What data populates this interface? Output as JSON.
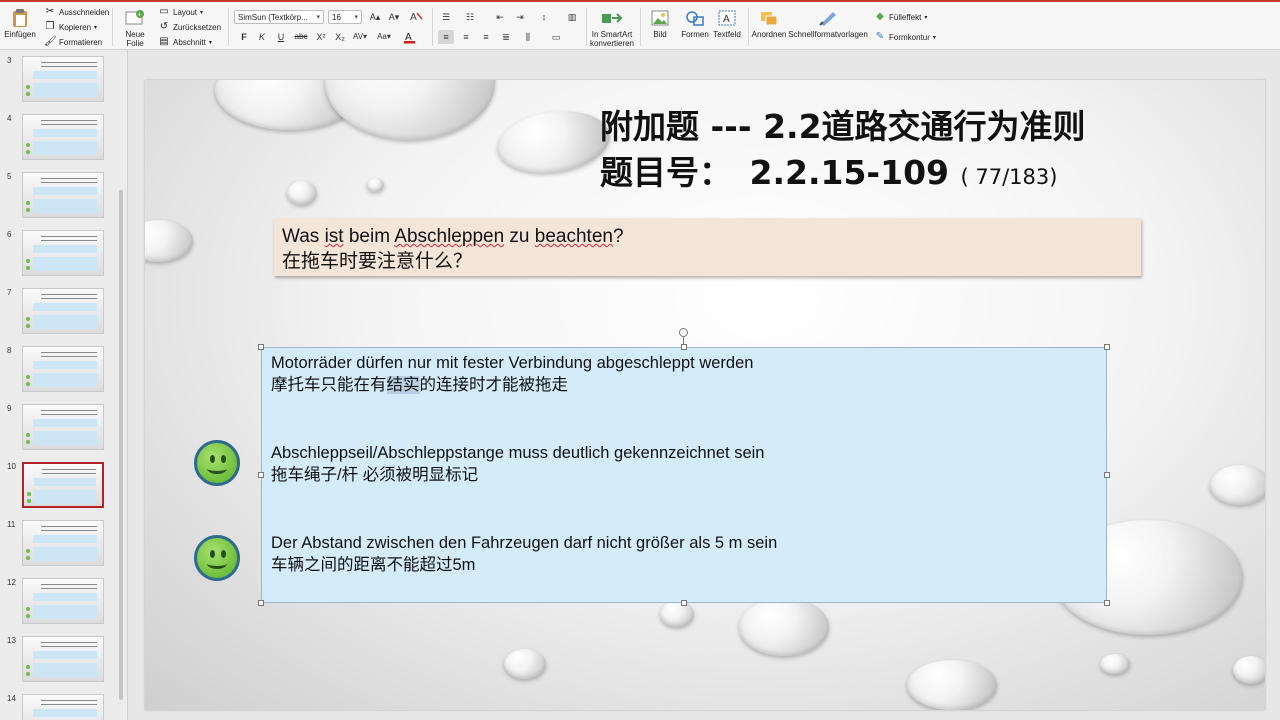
{
  "ribbon": {
    "paste_label": "Einfügen",
    "cut_label": "Ausschneiden",
    "copy_label": "Kopieren",
    "format_painter_label": "Formatieren",
    "new_slide_label": "Neue\nFolie",
    "layout_label": "Layout",
    "reset_label": "Zurücksetzen",
    "section_label": "Abschnitt",
    "font_name": "SimSun (Textkörp...",
    "font_size": "16",
    "picture_label": "Bild",
    "shapes_label": "Formen",
    "textbox_label": "Textfeld",
    "smartart_label": "In SmartArt\nkonvertieren",
    "arrange_label": "Anordnen",
    "quickstyles_label": "Schnellformatvorlagen",
    "fill_label": "Fülleffekt",
    "outline_label": "Formkontur",
    "bold": "F",
    "italic": "K",
    "underline": "U",
    "strike": "abc",
    "superscript": "X²",
    "subscript": "X₂",
    "accent_color": "#c43b2c"
  },
  "thumbnails": [
    {
      "num": "3"
    },
    {
      "num": "4"
    },
    {
      "num": "5"
    },
    {
      "num": "6"
    },
    {
      "num": "7"
    },
    {
      "num": "8"
    },
    {
      "num": "9"
    },
    {
      "num": "10",
      "active": true
    },
    {
      "num": "11"
    },
    {
      "num": "12"
    },
    {
      "num": "13"
    },
    {
      "num": "14"
    }
  ],
  "slide": {
    "title_line1": "附加题 --- 2.2道路交通行为准则",
    "title_line2_prefix": "题目号：",
    "title_line2_number": "2.2.15-109",
    "title_line2_count": "( 77/183)",
    "question_de_a": "Was ",
    "question_de_ist": "ist",
    "question_de_b": " beim ",
    "question_de_c": "Abschleppen",
    "question_de_d": " zu ",
    "question_de_e": "beachten",
    "question_de_f": "?",
    "question_zh": "在拖车时要注意什么？",
    "answers": [
      {
        "de": "Motorräder dürfen nur mit fester Verbindung abgeschleppt werden",
        "zh_a": "摩托车只能在有",
        "zh_hl": "结实",
        "zh_b": "的连接时才能被拖走"
      },
      {
        "de": "Abschleppseil/Abschleppstange muss deutlich gekennzeichnet sein",
        "zh_a": "拖车绳子/杆 必须被明显标记",
        "zh_hl": "",
        "zh_b": ""
      },
      {
        "de": "Der Abstand zwischen den Fahrzeugen darf nicht größer als 5 m sein",
        "zh_a": "车辆之间的距离不能超过5m",
        "zh_hl": "",
        "zh_b": ""
      }
    ]
  }
}
